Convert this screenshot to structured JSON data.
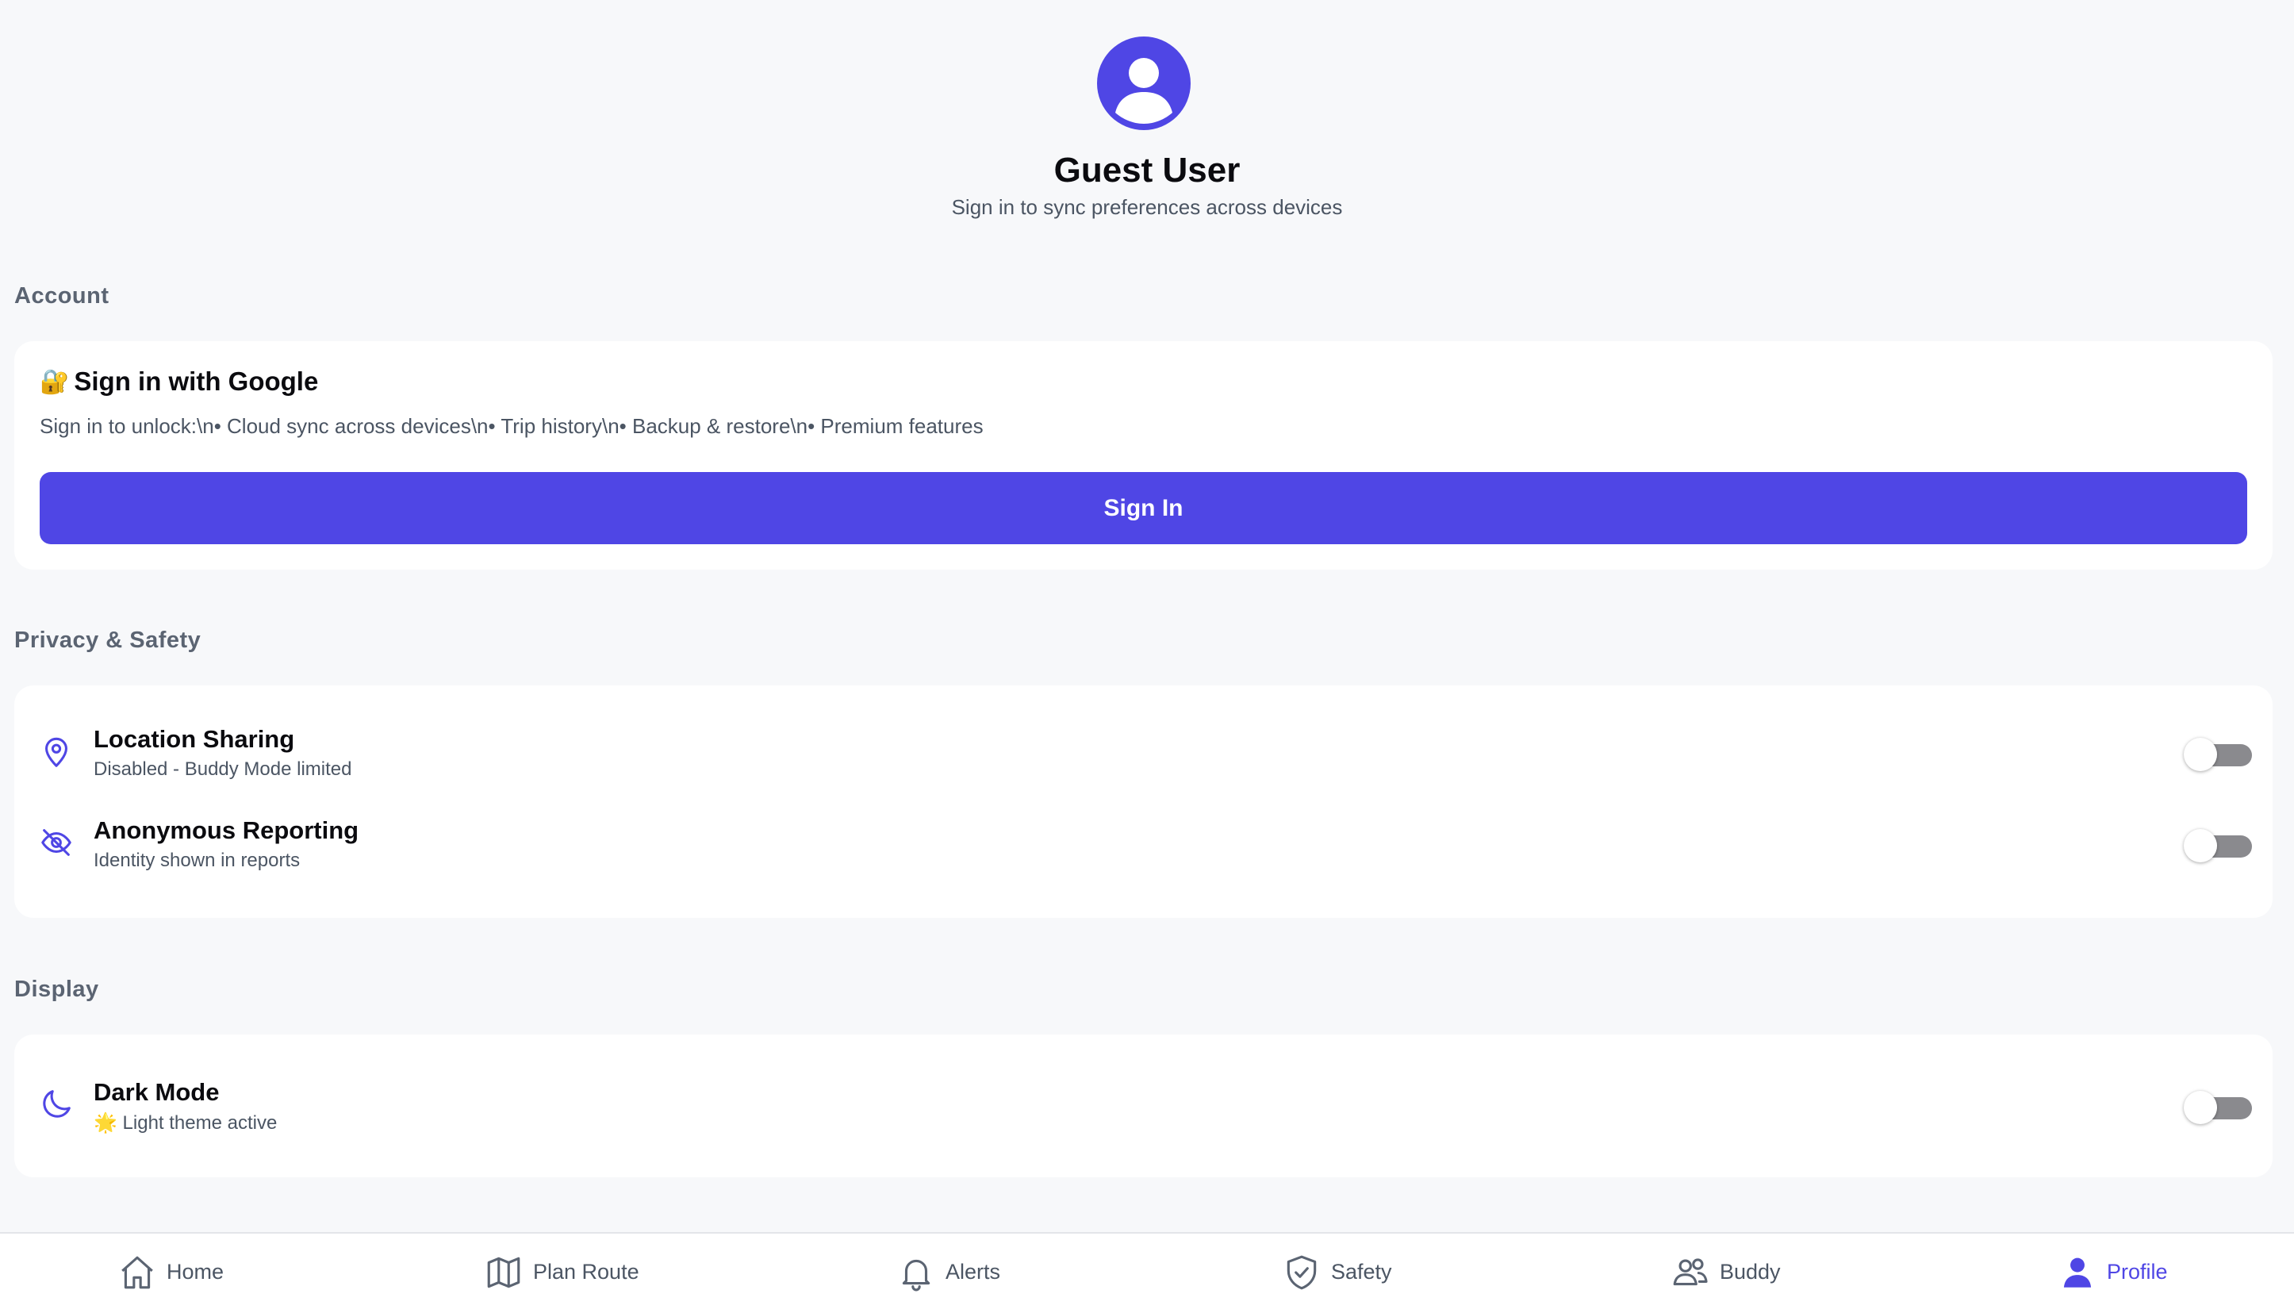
{
  "profile": {
    "name": "Guest User",
    "subtitle": "Sign in to sync preferences across devices"
  },
  "sections": {
    "account": "Account",
    "privacy": "Privacy & Safety",
    "display": "Display"
  },
  "account_card": {
    "emoji": "🔐",
    "title": "Sign in with Google",
    "description": "Sign in to unlock:\\n• Cloud sync across devices\\n• Trip history\\n• Backup & restore\\n• Premium features",
    "button_label": "Sign In"
  },
  "privacy_settings": [
    {
      "title": "Location Sharing",
      "subtitle": "Disabled - Buddy Mode limited",
      "icon": "location-pin-icon",
      "enabled": false
    },
    {
      "title": "Anonymous Reporting",
      "subtitle": "Identity shown in reports",
      "icon": "eye-slash-icon",
      "enabled": false
    }
  ],
  "display_settings": [
    {
      "title": "Dark Mode",
      "subtitle": "🌟 Light theme active",
      "icon": "moon-icon",
      "enabled": false
    }
  ],
  "nav": [
    {
      "label": "Home",
      "icon": "home-icon",
      "active": false
    },
    {
      "label": "Plan Route",
      "icon": "map-icon",
      "active": false
    },
    {
      "label": "Alerts",
      "icon": "bell-icon",
      "active": false
    },
    {
      "label": "Safety",
      "icon": "shield-check-icon",
      "active": false
    },
    {
      "label": "Buddy",
      "icon": "users-icon",
      "active": false
    },
    {
      "label": "Profile",
      "icon": "user-icon",
      "active": true
    }
  ],
  "colors": {
    "accent": "#4f46e5",
    "background": "#f7f8fa",
    "card": "#ffffff",
    "muted_text": "#4b5563",
    "toggle_off": "#8a8a8e"
  }
}
